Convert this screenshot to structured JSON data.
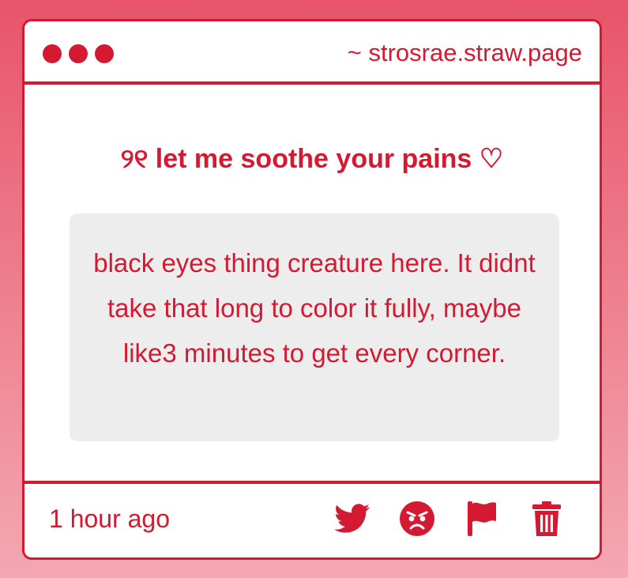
{
  "window": {
    "url": "~ strosrae.straw.page"
  },
  "post": {
    "title": "୨୧ let me soothe your pains ♡",
    "message": "black eyes thing creature here. It didnt take that long to color it fully, maybe like3 minutes to get every corner.",
    "timestamp": "1 hour ago"
  },
  "actions": [
    {
      "icon": "twitter-icon",
      "label": "share to twitter"
    },
    {
      "icon": "angry-face-icon",
      "label": "react"
    },
    {
      "icon": "flag-icon",
      "label": "report"
    },
    {
      "icon": "trash-icon",
      "label": "delete"
    }
  ],
  "colors": {
    "accent": "#d41a32",
    "box_background": "#ededee",
    "page_gradient_top": "#e8546a",
    "page_gradient_bottom": "#f4a8b1"
  }
}
